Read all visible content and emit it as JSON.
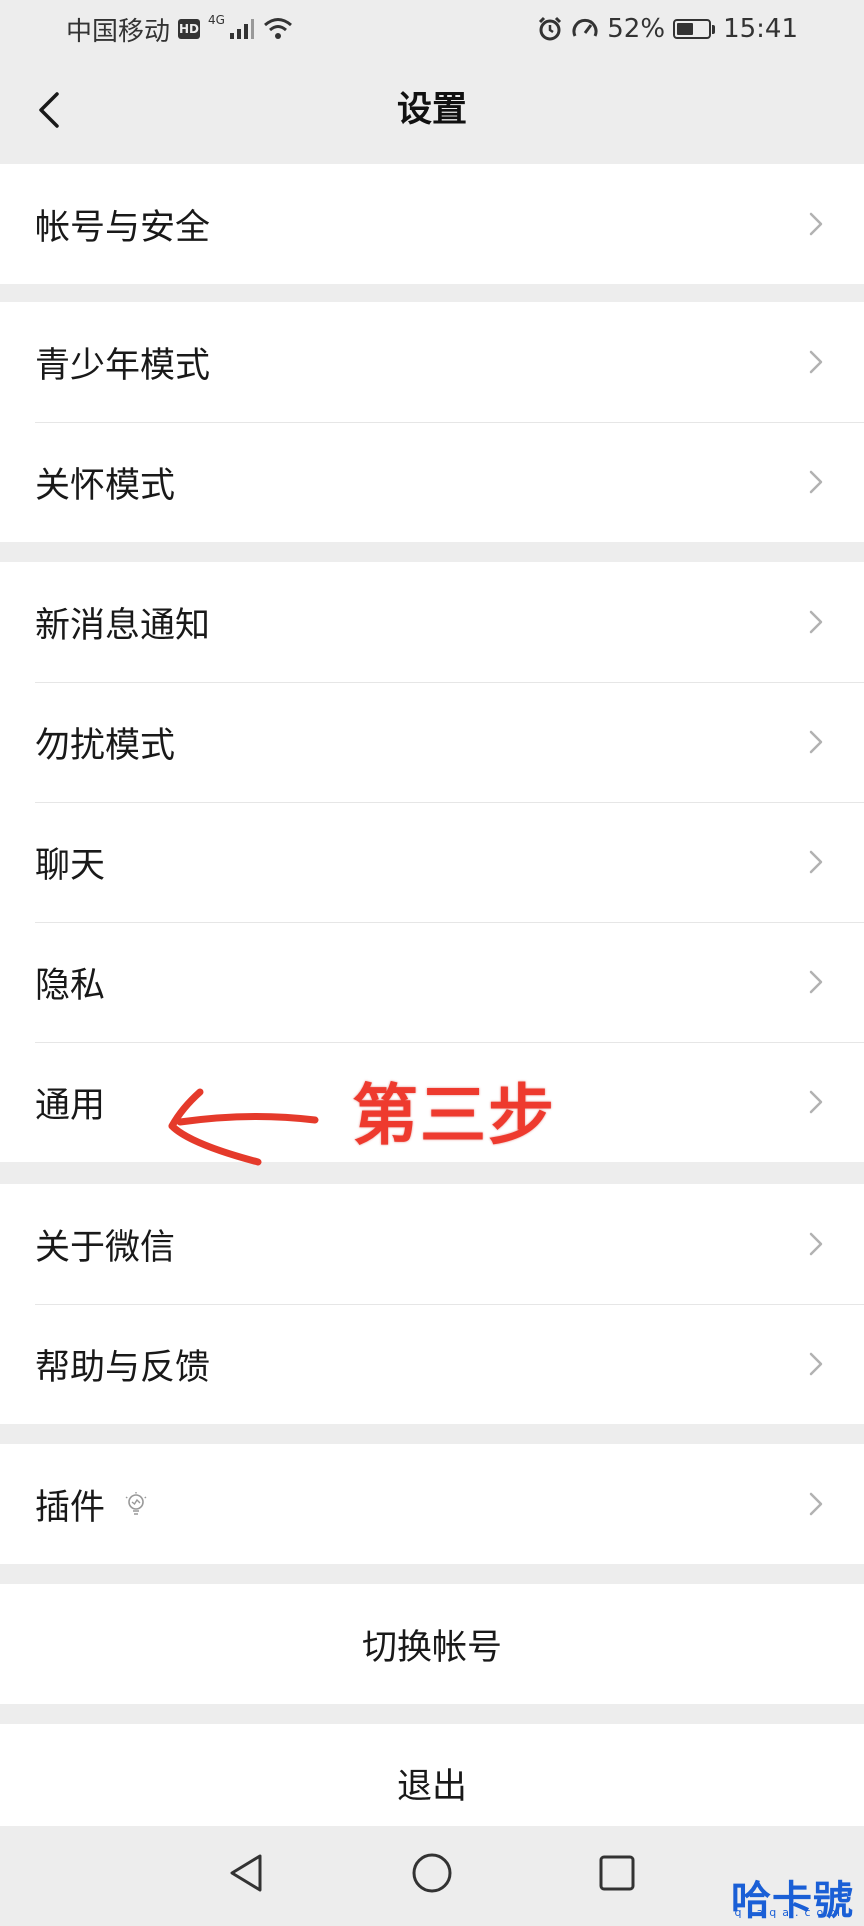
{
  "status_bar": {
    "carrier": "中国移动",
    "hd": "HD",
    "network": "4G",
    "battery": "52%",
    "battery_level": 0.52,
    "time": "15:41",
    "icons": [
      "signal-icon",
      "wifi-icon",
      "alarm-icon",
      "speed-icon",
      "battery-icon"
    ]
  },
  "navbar": {
    "title": "设置",
    "back_icon": "chevron-left-icon"
  },
  "groups": [
    {
      "items": [
        {
          "label": "帐号与安全"
        }
      ]
    },
    {
      "items": [
        {
          "label": "青少年模式"
        },
        {
          "label": "关怀模式"
        }
      ]
    },
    {
      "items": [
        {
          "label": "新消息通知"
        },
        {
          "label": "勿扰模式"
        },
        {
          "label": "聊天"
        },
        {
          "label": "隐私"
        },
        {
          "label": "通用"
        }
      ]
    },
    {
      "items": [
        {
          "label": "关于微信"
        },
        {
          "label": "帮助与反馈"
        }
      ]
    },
    {
      "items": [
        {
          "label": "插件",
          "icon": "bulb-icon"
        }
      ]
    }
  ],
  "actions": {
    "switch_account": "切换帐号",
    "logout": "退出"
  },
  "annotation": {
    "text": "第三步",
    "color": "#ee3a2e"
  },
  "system_nav": {
    "icons": [
      "back-triangle-icon",
      "home-circle-icon",
      "recents-square-icon"
    ]
  },
  "watermark": {
    "text": "哈卡號",
    "sub": "qiaqa.com"
  }
}
